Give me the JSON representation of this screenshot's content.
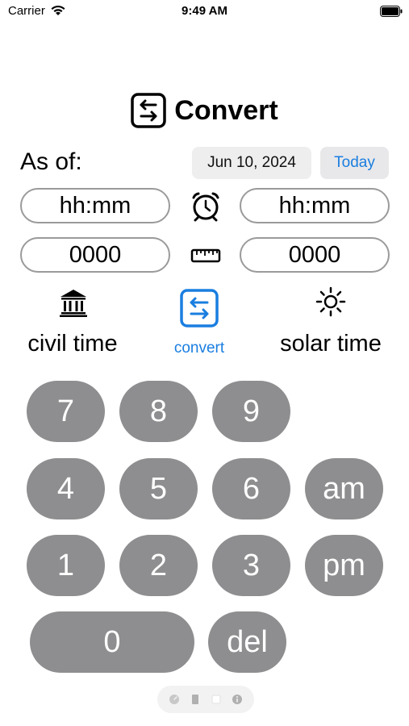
{
  "status_bar": {
    "carrier": "Carrier",
    "time": "9:49 AM",
    "icons": [
      "wifi-icon",
      "battery-icon"
    ]
  },
  "header": {
    "title": "Convert",
    "icon": "convert-arrows-icon"
  },
  "as_of": {
    "label": "As of:",
    "date": "Jun 10, 2024",
    "today_label": "Today"
  },
  "fields": {
    "civil_time_value": "hh:mm",
    "solar_time_value": "hh:mm",
    "civil_number_value": "0000",
    "solar_number_value": "0000",
    "time_icon": "clock-icon",
    "number_icon": "ruler-icon"
  },
  "modes": {
    "civil": {
      "label": "civil time",
      "icon": "bank-icon"
    },
    "convert": {
      "label": "convert",
      "icon": "convert-arrows-icon"
    },
    "solar": {
      "label": "solar time",
      "icon": "sun-icon"
    }
  },
  "keypad": {
    "k7": "7",
    "k8": "8",
    "k9": "9",
    "k4": "4",
    "k5": "5",
    "k6": "6",
    "am": "am",
    "k1": "1",
    "k2": "2",
    "k3": "3",
    "pm": "pm",
    "k0": "0",
    "del": "del"
  },
  "toolbar": {
    "icons": [
      "gauge-icon",
      "document-icon",
      "square-icon",
      "info-icon"
    ]
  },
  "colors": {
    "accent": "#1a7ee0",
    "key": "#8e8e90",
    "field_border": "#9a9a9a"
  }
}
